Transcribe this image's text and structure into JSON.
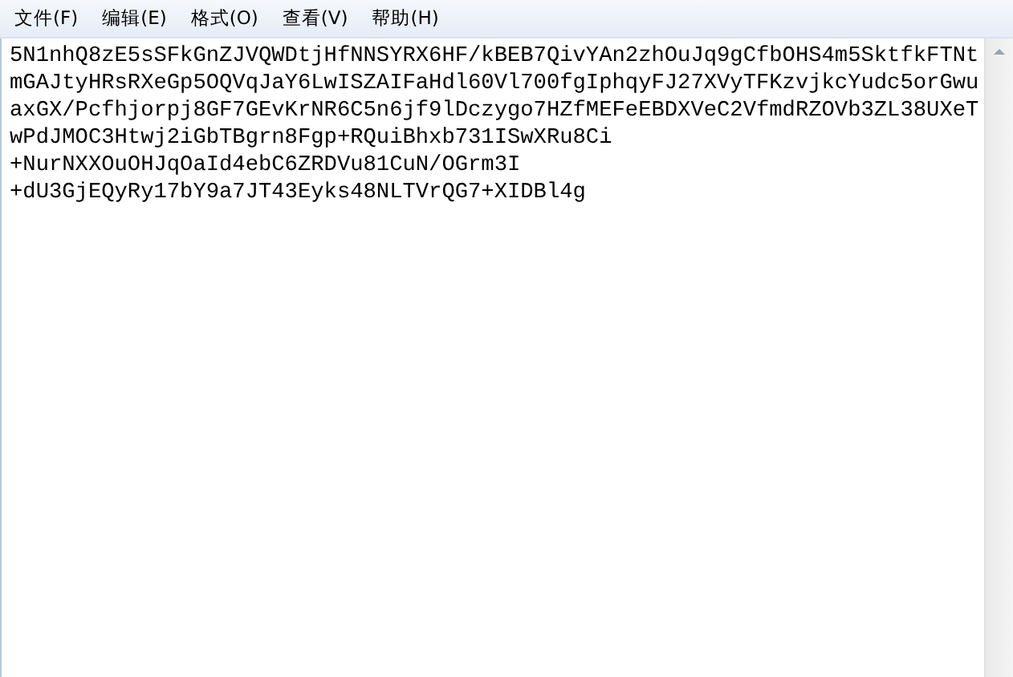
{
  "menu": [
    {
      "label": "文件(F)"
    },
    {
      "label": "编辑(E)"
    },
    {
      "label": "格式(O)"
    },
    {
      "label": "查看(V)"
    },
    {
      "label": "帮助(H)"
    }
  ],
  "editor": {
    "lines": [
      "5N1nhQ8zE5sSFkGnZJVQWDtjHfNNSYRX6HF/kBEB7QivYAn2zhOuJq9gCfbOHS4m5SktfkFTNt",
      "mGAJtyHRsRXeGp5OQVqJaY6LwISZAIFaHdl60Vl700fgIphqyFJ27XVyTFKzvjkcYudc5orGwu",
      "axGX/Pcfhjorpj8GF7GEvKrNR6C5n6jf9lDczygo7HZfMEFeEBDXVeC2VfmdRZOVb3ZL38UXeT",
      "wPdJMOC3Htwj2iGbTBgrn8Fgp+RQuiBhxb731ISwXRu8Ci",
      "+NurNXXOuOHJqOaId4ebC6ZRDVu81CuN/OGrm3I",
      "+dU3GjEQyRy17bY9a7JT43Eyks48NLTVrQG7+XIDBl4g"
    ]
  }
}
